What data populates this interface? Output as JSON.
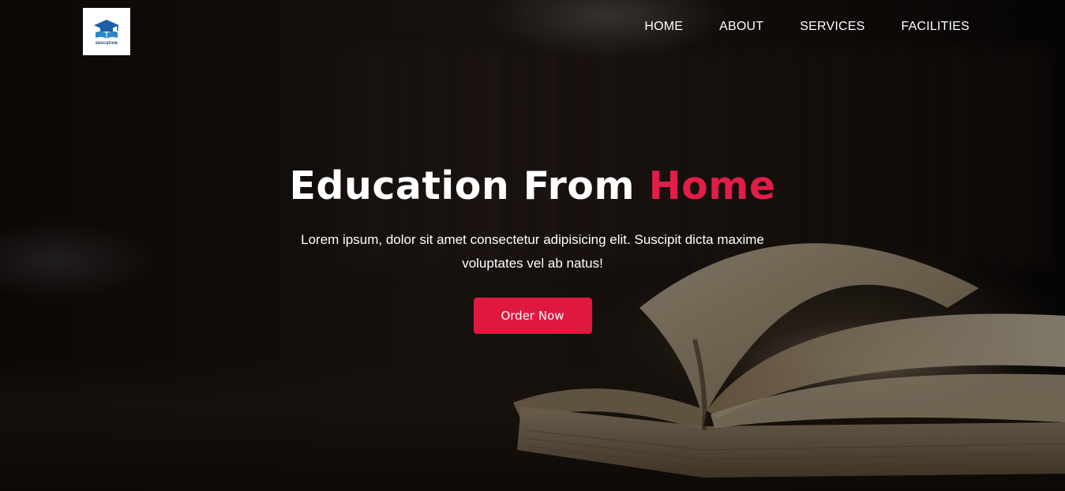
{
  "brand": {
    "logo_icon": "graduation-cap-book-icon",
    "logo_text": "EDUCATION"
  },
  "nav": {
    "items": [
      {
        "label": "HOME"
      },
      {
        "label": "ABOUT"
      },
      {
        "label": "SERVICES"
      },
      {
        "label": "FACILITIES"
      }
    ]
  },
  "hero": {
    "title_main": "Education From",
    "title_accent": "Home",
    "description": "Lorem ipsum, dolor sit amet consectetur adipisicing elit. Suscipit dicta maxime voluptates vel ab natus!",
    "cta_label": "Order Now",
    "background_image": "open-book-on-table-photo"
  },
  "colors": {
    "accent": "#e11d48",
    "button": "#e0173f",
    "text": "#ffffff"
  }
}
